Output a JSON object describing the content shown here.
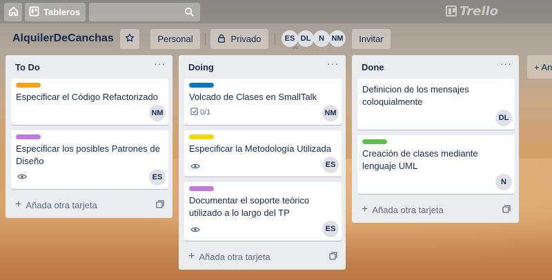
{
  "colors": {
    "orange": "#ff9f1a",
    "purple": "#c377e0",
    "blue": "#0079bf",
    "yellow": "#f2d600",
    "green": "#61bd4f"
  },
  "header": {
    "boards_label": "Tableros",
    "logo_text": "Trello",
    "icons": [
      "home-icon",
      "board-icon",
      "search-icon"
    ]
  },
  "board": {
    "title": "AlquilerDeCanchas",
    "team_label": "Personal",
    "visibility_label": "Privado",
    "members": [
      "ES",
      "DL",
      "N",
      "NM"
    ],
    "invite_label": "Invitar",
    "add_list_label": "+ An"
  },
  "lists": [
    {
      "title": "To Do",
      "add_label": "Añada otra tarjeta",
      "cards": [
        {
          "label": "orange",
          "text": "Especificar el Código Refactorizado",
          "member": "NM"
        },
        {
          "label": "purple",
          "text": "Especificar los posibles Patrones de Diseño",
          "member": "ES",
          "watching": true
        }
      ]
    },
    {
      "title": "Doing",
      "add_label": "Añada otra tarjeta",
      "cards": [
        {
          "label": "blue",
          "text": "Volcado de Clases en SmallTalk",
          "member": "NM",
          "checklist": "0/1"
        },
        {
          "label": "yellow",
          "text": "Especificar la Metodología Utilizada",
          "member": "ES",
          "watching": true
        },
        {
          "label": "purple",
          "text": "Documentar el soporte teórico utilizado a lo largo del TP",
          "member": "ES",
          "watching": true
        }
      ]
    },
    {
      "title": "Done",
      "add_label": "Añada otra tarjeta",
      "cards": [
        {
          "text": "Definicion de los mensajes coloquialmente",
          "member": "DL"
        },
        {
          "label": "green",
          "text": "Creación de clases mediante lenguaje UML",
          "member": "N"
        }
      ]
    }
  ]
}
